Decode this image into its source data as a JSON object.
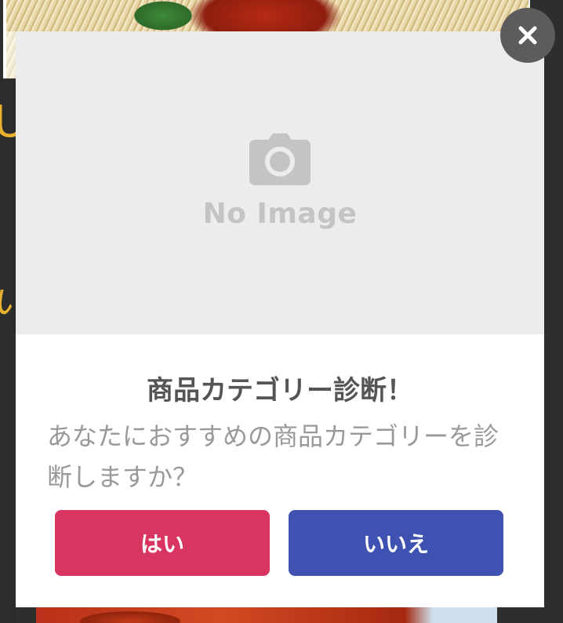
{
  "background": {
    "glyph_top": "U",
    "glyph_bottom": "い"
  },
  "modal": {
    "image_placeholder_text": "No Image",
    "image_icon": "camera-icon",
    "title": "商品カテゴリー診断！",
    "message": "あなたにおすすめの商品カテゴリーを診断しますか？",
    "yes_label": "はい",
    "no_label": "いいえ",
    "close_icon": "close-icon"
  },
  "colors": {
    "yes_button": "#d93563",
    "no_button": "#3f51b1",
    "close_button": "#5c5c5c",
    "accent_yellow": "#e8b22e"
  }
}
